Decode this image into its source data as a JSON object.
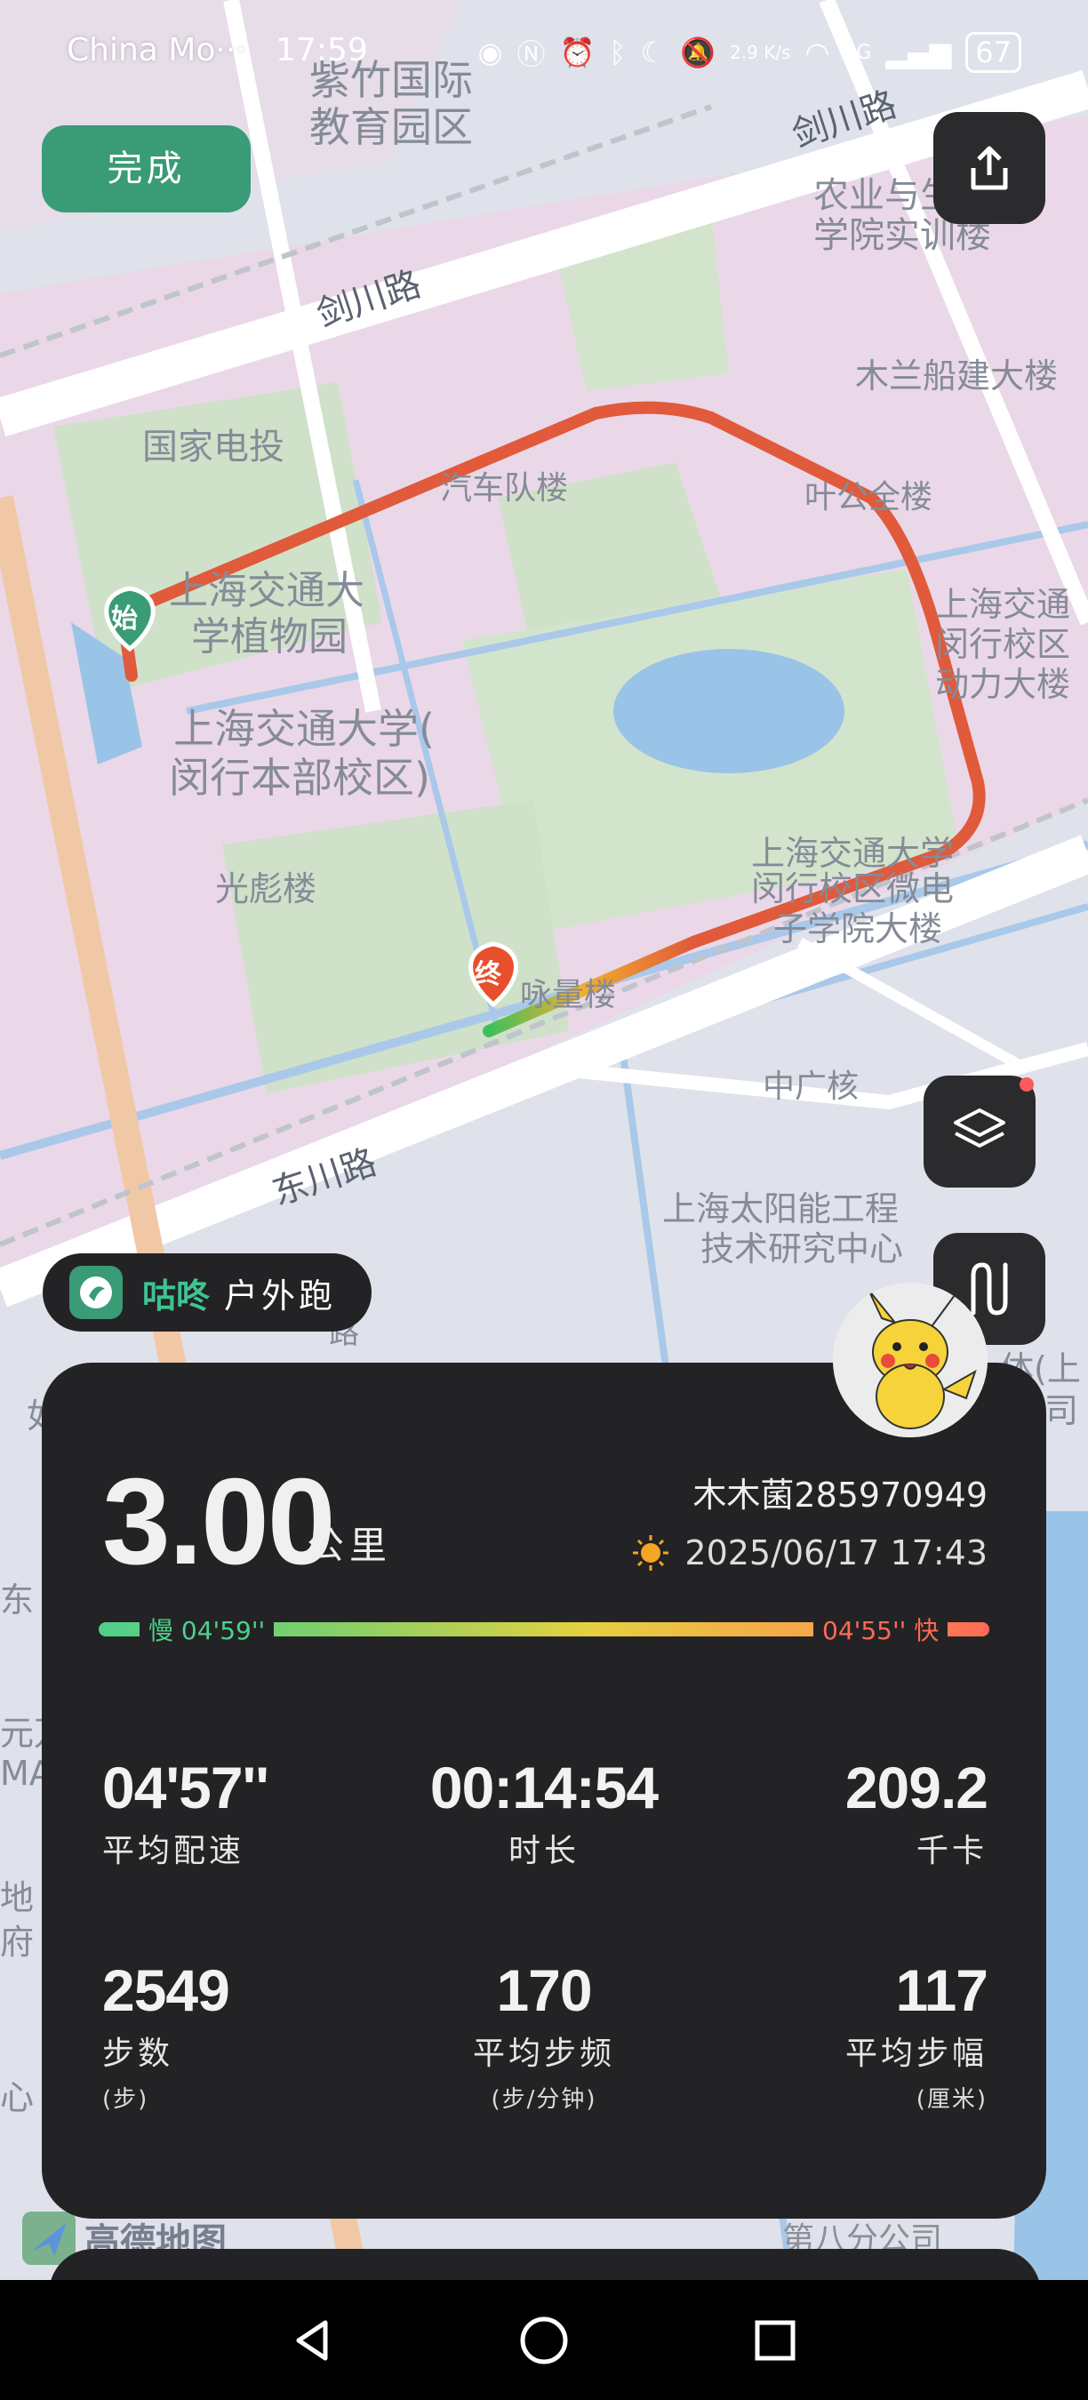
{
  "status_bar": {
    "carrier": "China Mo···",
    "time": "17:59",
    "net_speed": "2.9 K/s",
    "network": "4G",
    "battery": "67"
  },
  "map": {
    "labels": [
      {
        "id": "zizhu",
        "text": "紫竹国际"
      },
      {
        "id": "zizhu2",
        "text": "教育园区"
      },
      {
        "id": "jianchuan1",
        "text": "剑川路"
      },
      {
        "id": "jianchuan2",
        "text": "剑川路"
      },
      {
        "id": "nongye1",
        "text": "农业与生"
      },
      {
        "id": "nongye2",
        "text": "学院实训楼"
      },
      {
        "id": "mulan",
        "text": "木兰船建大楼"
      },
      {
        "id": "dianto",
        "text": "国家电投"
      },
      {
        "id": "qiche",
        "text": "汽车队楼"
      },
      {
        "id": "yegong",
        "text": "叶公全楼"
      },
      {
        "id": "sjtu_bot1",
        "text": "上海交通大"
      },
      {
        "id": "sjtu_bot2",
        "text": "学植物园"
      },
      {
        "id": "sjtu_dong1",
        "text": "上海交通"
      },
      {
        "id": "sjtu_dong2",
        "text": "闵行校区"
      },
      {
        "id": "sjtu_dong3",
        "text": "动力大楼"
      },
      {
        "id": "sjtu_main1",
        "text": "上海交通大学("
      },
      {
        "id": "sjtu_main2",
        "text": "闵行本部校区)"
      },
      {
        "id": "guangbiao",
        "text": "光彪楼"
      },
      {
        "id": "wd1",
        "text": "上海交通大学"
      },
      {
        "id": "wd2",
        "text": "闵行校区微电"
      },
      {
        "id": "wd3",
        "text": "子学院大楼"
      },
      {
        "id": "yongmei",
        "text": "咏量楼"
      },
      {
        "id": "zhongguang",
        "text": "中广核"
      },
      {
        "id": "dongchuan",
        "text": "东川路"
      },
      {
        "id": "solar1",
        "text": "上海太阳能工程"
      },
      {
        "id": "solar2",
        "text": "技术研究中心"
      },
      {
        "id": "edge1",
        "text": "东"
      },
      {
        "id": "edge2",
        "text": "元万"
      },
      {
        "id": "edge3",
        "text": "MA"
      },
      {
        "id": "edge4",
        "text": "地"
      },
      {
        "id": "edge5",
        "text": "府"
      },
      {
        "id": "edge6",
        "text": "心"
      },
      {
        "id": "edge7",
        "text": "体(上"
      },
      {
        "id": "edge8",
        "text": "司"
      },
      {
        "id": "edge9",
        "text": "如"
      },
      {
        "id": "edge10",
        "text": "路"
      }
    ],
    "start_marker": "始",
    "end_marker": "终",
    "amap_logo": "高德地图",
    "fourth_branch": "第八分公司"
  },
  "buttons": {
    "done": "完成"
  },
  "brand": {
    "name": "咕咚",
    "activity": "户外跑"
  },
  "summary": {
    "distance": "3.00",
    "distance_unit": "公里",
    "user": "木木菌285970949",
    "datetime": "2025/06/17  17:43",
    "pace_slow_label": "慢 04'59''",
    "pace_fast_label": "04'55'' 快"
  },
  "stats": {
    "avg_pace": {
      "value": "04'57''",
      "label": "平均配速"
    },
    "duration": {
      "value": "00:14:54",
      "label": "时长"
    },
    "calories": {
      "value": "209.2",
      "label": "千卡"
    },
    "steps": {
      "value": "2549",
      "label": "步数",
      "unit": "(步)"
    },
    "cadence": {
      "value": "170",
      "label": "平均步频",
      "unit": "(步/分钟)"
    },
    "stride": {
      "value": "117",
      "label": "平均步幅",
      "unit": "(厘米)"
    }
  }
}
